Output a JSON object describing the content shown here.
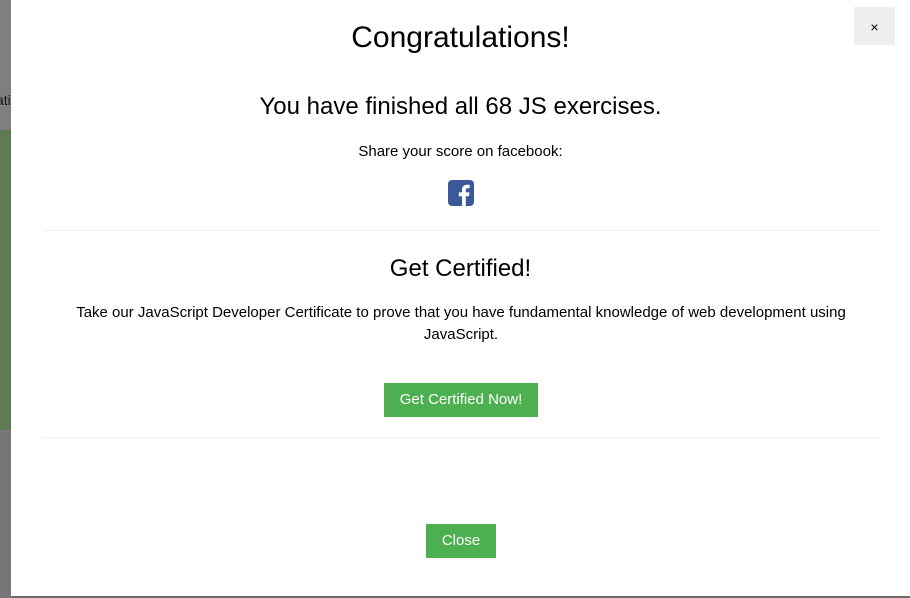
{
  "background": {
    "partial_text": "ati"
  },
  "modal": {
    "close_x": "×",
    "title": "Congratulations!",
    "subtitle": "You have finished all 68 JS exercises.",
    "share_text": "Share your score on facebook:",
    "facebook_icon": "facebook-square-icon",
    "cert_title": "Get Certified!",
    "cert_description": "Take our JavaScript Developer Certificate to prove that you have fundamental knowledge of web development using JavaScript.",
    "cert_button": "Get Certified Now!",
    "close_button": "Close"
  },
  "colors": {
    "accent_green": "#4caf50",
    "facebook_blue": "#3b5998",
    "close_x_bg": "#eeeeee"
  }
}
